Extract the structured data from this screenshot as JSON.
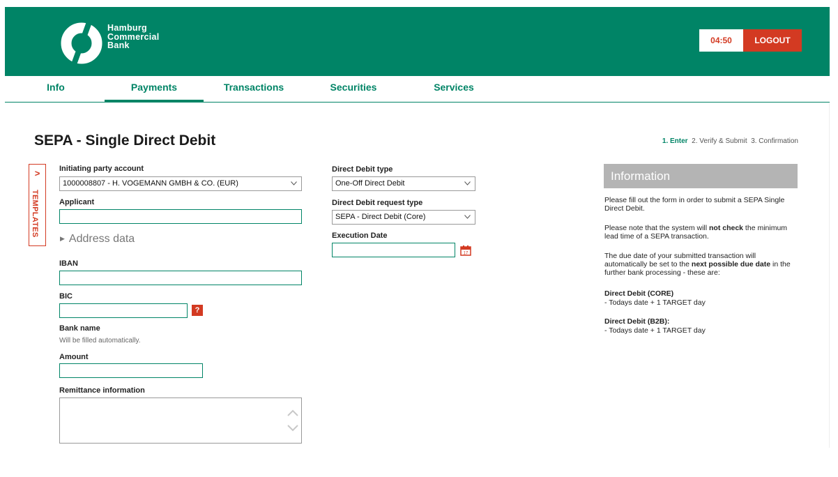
{
  "brand": {
    "line1": "Hamburg",
    "line2": "Commercial",
    "line3": "Bank"
  },
  "session": {
    "timer": "04:50",
    "logout_label": "LOGOUT"
  },
  "nav": {
    "info": "Info",
    "payments": "Payments",
    "transactions": "Transactions",
    "securities": "Securities",
    "services": "Services",
    "active": "Payments"
  },
  "page": {
    "title": "SEPA - Single Direct Debit",
    "steps": {
      "step1": "1. Enter",
      "step2": "2. Verify & Submit",
      "step3": "3. Confirmation"
    }
  },
  "templates": {
    "chevron": ">",
    "label": "TEMPLATES"
  },
  "form": {
    "initiating_party_label": "Initiating party account",
    "initiating_party_value": "1000008807 - H. VOGEMANN GMBH & CO. (EUR)",
    "applicant_label": "Applicant",
    "applicant_value": "",
    "address_data_label": "Address data",
    "iban_label": "IBAN",
    "iban_value": "",
    "bic_label": "BIC",
    "bic_value": "",
    "bic_help": "?",
    "bank_name_label": "Bank name",
    "bank_name_hint": "Will be filled automatically.",
    "amount_label": "Amount",
    "amount_value": "",
    "remittance_label": "Remittance information",
    "remittance_value": "",
    "dd_type_label": "Direct Debit type",
    "dd_type_value": "One-Off Direct Debit",
    "dd_request_label": "Direct Debit request type",
    "dd_request_value": "SEPA - Direct Debit (Core)",
    "execution_date_label": "Execution Date",
    "execution_date_value": "",
    "calendar_day": "17"
  },
  "info": {
    "title": "Information",
    "p1": "Please fill out the form in order to submit a SEPA Single Direct Debit.",
    "p2_pre": "Please note that the system will ",
    "p2_bold": "not check",
    "p2_post": " the minimum lead time of a SEPA transaction.",
    "p3_pre": "The due date of your submitted transaction will automatically be set to the ",
    "p3_bold": "next possible due date",
    "p3_post": " in the further bank processing - these are:",
    "core_title": "Direct Debit (CORE)",
    "core_text": "- Todays date + 1 TARGET day",
    "b2b_title": "Direct Debit (B2B):",
    "b2b_text": "- Todays date + 1 TARGET day"
  },
  "colors": {
    "brand_green": "#008466",
    "accent_red": "#d33a22",
    "info_header_gray": "#b4b4b4"
  },
  "icons": {
    "logo": "hcob-logo-icon",
    "dropdown": "chevron-down-icon",
    "help": "help-icon",
    "calendar": "calendar-icon",
    "scroll_up": "chevron-up-icon",
    "scroll_down": "chevron-down-icon"
  }
}
